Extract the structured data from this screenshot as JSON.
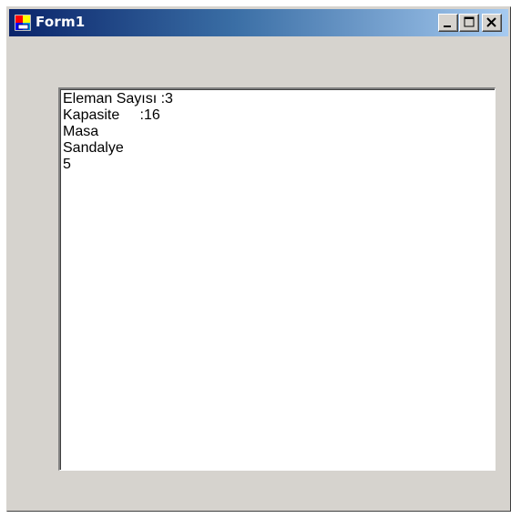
{
  "window": {
    "title": "Form1",
    "caption_buttons": {
      "minimize_icon": "minimize-icon",
      "maximize_icon": "maximize-icon",
      "close_icon": "close-icon"
    }
  },
  "listbox": {
    "items": [
      "Eleman Sayısı :3",
      "Kapasite     :16",
      "Masa",
      "Sandalye",
      "5"
    ]
  },
  "colors": {
    "titlebar_start": "#0a246a",
    "titlebar_end": "#a6caf0",
    "window_face": "#d6d3ce"
  }
}
